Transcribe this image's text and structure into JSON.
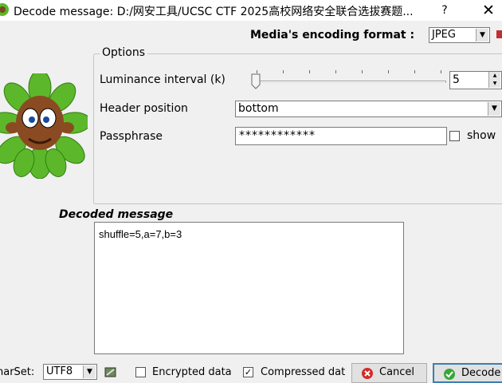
{
  "window": {
    "title": "Decode message: D:/网安工具/UCSC CTF 2025高校网络安全联合选拔赛题...",
    "help_label": "?",
    "close_label": "✕"
  },
  "format": {
    "label": "Media's encoding format :",
    "value": "JPEG"
  },
  "options": {
    "legend": "Options",
    "luminance": {
      "label": "Luminance interval (k)",
      "value": "5",
      "slider_level": 0.02
    },
    "header": {
      "label": "Header position",
      "value": "bottom"
    },
    "passphrase": {
      "label": "Passphrase",
      "value": "************",
      "show_label": "show",
      "show_checked": false
    }
  },
  "decoded": {
    "heading": "Decoded message",
    "text": "shuffle=5,a=7,b=3"
  },
  "footer": {
    "charset_label": "harSet:",
    "charset_value": "UTF8",
    "encrypted_label": "Encrypted data",
    "encrypted_checked": false,
    "compressed_label": "Compressed dat",
    "compressed_checked": true,
    "compressed_mark": "✓",
    "cancel_label": "Cancel",
    "decode_label": "Decode"
  },
  "icons": {
    "app": "app-icon",
    "mascot": "mascot-leaves-icon",
    "charset": "charset-edit-icon",
    "cancel": "cancel-icon",
    "decode": "decode-check-icon"
  },
  "colors": {
    "accent_blue": "#3c7fb1",
    "leaf_green": "#5cb82a",
    "cancel_red": "#d42a2a",
    "decode_green": "#3aa53a"
  }
}
